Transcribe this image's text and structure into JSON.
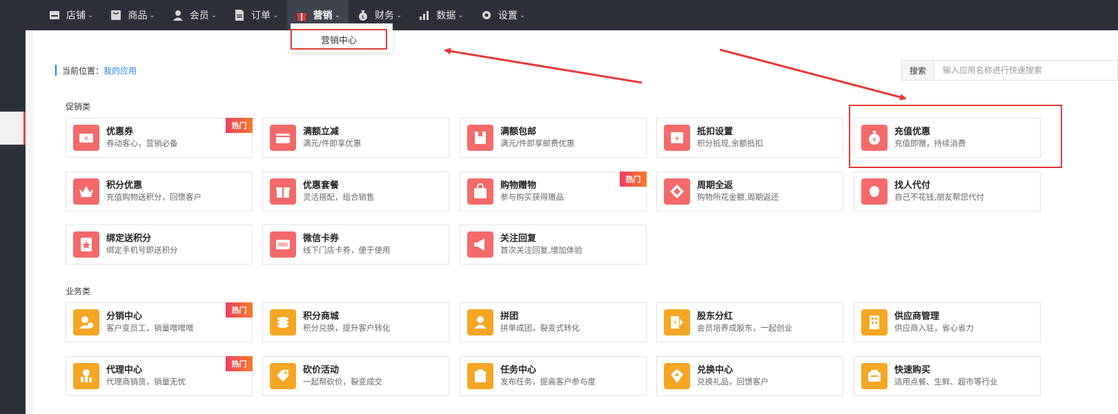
{
  "nav": {
    "items": [
      {
        "label": "店铺",
        "icon": "store-icon"
      },
      {
        "label": "商品",
        "icon": "goods-icon"
      },
      {
        "label": "会员",
        "icon": "member-icon"
      },
      {
        "label": "订单",
        "icon": "order-icon"
      },
      {
        "label": "营销",
        "icon": "gift-icon"
      },
      {
        "label": "财务",
        "icon": "money-bag-icon"
      },
      {
        "label": "数据",
        "icon": "bar-chart-icon"
      },
      {
        "label": "设置",
        "icon": "gear-icon"
      }
    ],
    "active_index": 4
  },
  "dropdown": {
    "item": "营销中心"
  },
  "breadcrumb": {
    "prefix": "当前位置：",
    "link": "我的应用"
  },
  "search": {
    "label": "搜索",
    "placeholder": "输入应用名称进行快速搜索"
  },
  "sections": {
    "promo": {
      "title": "促销类",
      "cards": [
        {
          "title": "优惠券",
          "desc": "券动客心，营销必备",
          "hot": "热门",
          "color": "red",
          "icon": "coupon-icon"
        },
        {
          "title": "满额立减",
          "desc": "满元/件即享优惠",
          "hot": "",
          "color": "red",
          "icon": "wallet-icon"
        },
        {
          "title": "满额包邮",
          "desc": "满元/件即享邮费优惠",
          "hot": "",
          "color": "red",
          "icon": "package-icon"
        },
        {
          "title": "抵扣设置",
          "desc": "积分抵现,余额抵扣",
          "hot": "",
          "color": "red",
          "icon": "deduct-icon"
        },
        {
          "title": "充值优惠",
          "desc": "充值即赠，持续消费",
          "hot": "",
          "color": "red",
          "icon": "money-bag-icon"
        },
        {
          "title": "积分优惠",
          "desc": "充值购物送积分，回馈客户",
          "hot": "",
          "color": "red",
          "icon": "crown-icon"
        },
        {
          "title": "优惠套餐",
          "desc": "灵活搭配，组合销售",
          "hot": "",
          "color": "red",
          "icon": "gift-box-icon"
        },
        {
          "title": "购物赠物",
          "desc": "参与购买获得赠品",
          "hot": "热门",
          "color": "red",
          "icon": "shopping-bag-icon"
        },
        {
          "title": "周期全返",
          "desc": "购物所花金额,周期返还",
          "hot": "",
          "color": "red",
          "icon": "diamond-icon"
        },
        {
          "title": "找人代付",
          "desc": "自己不花钱,朋友帮您代付",
          "hot": "",
          "color": "red",
          "icon": "santa-icon"
        },
        {
          "title": "绑定送积分",
          "desc": "绑定手机号即送积分",
          "hot": "",
          "color": "red",
          "icon": "badge-icon"
        },
        {
          "title": "微信卡券",
          "desc": "线下门店卡券，便于使用",
          "hot": "",
          "color": "red",
          "icon": "card-icon"
        },
        {
          "title": "关注回复",
          "desc": "首次关注回复,增加体验",
          "hot": "",
          "color": "red",
          "icon": "megaphone-icon"
        }
      ]
    },
    "business": {
      "title": "业务类",
      "cards": [
        {
          "title": "分销中心",
          "desc": "客户变员工，销量噌噌噌",
          "hot": "热门",
          "color": "yellow",
          "icon": "distributor-icon"
        },
        {
          "title": "积分商城",
          "desc": "积分兑换，提升客户转化",
          "hot": "",
          "color": "yellow",
          "icon": "coins-icon"
        },
        {
          "title": "拼团",
          "desc": "拼单成团，裂变式转化",
          "hot": "",
          "color": "yellow",
          "icon": "group-icon"
        },
        {
          "title": "股东分红",
          "desc": "会员培养成股东，一起创业",
          "hot": "",
          "color": "yellow",
          "icon": "dividend-icon"
        },
        {
          "title": "供应商管理",
          "desc": "供应商入驻，省心省力",
          "hot": "",
          "color": "yellow",
          "icon": "building-icon"
        },
        {
          "title": "代理中心",
          "desc": "代理商销货，销量无忧",
          "hot": "热门",
          "color": "yellow",
          "icon": "agent-icon"
        },
        {
          "title": "砍价活动",
          "desc": "一起帮砍价，裂变成交",
          "hot": "",
          "color": "yellow",
          "icon": "tag-icon"
        },
        {
          "title": "任务中心",
          "desc": "发布任务，提高客户参与度",
          "hot": "",
          "color": "yellow",
          "icon": "task-icon"
        },
        {
          "title": "兑换中心",
          "desc": "兑换礼品，回馈客户",
          "hot": "",
          "color": "yellow",
          "icon": "exchange-icon"
        },
        {
          "title": "快速购买",
          "desc": "适用点餐、生鲜、超市等行业",
          "hot": "",
          "color": "yellow",
          "icon": "quick-buy-icon"
        }
      ]
    }
  }
}
